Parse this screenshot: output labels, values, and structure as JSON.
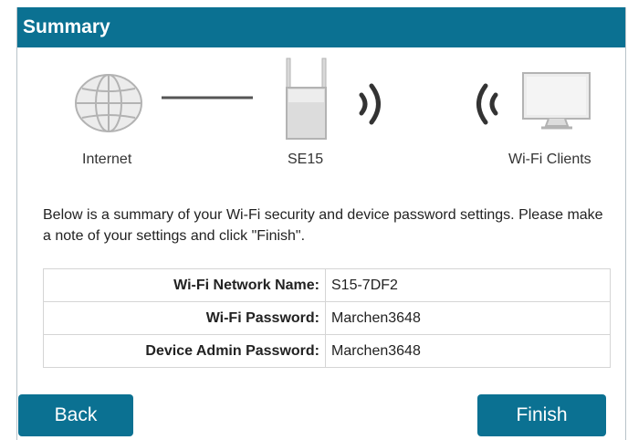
{
  "header": {
    "title": "Summary"
  },
  "diagram": {
    "internet_label": "Internet",
    "device_label": "SE15",
    "clients_label": "Wi-Fi Clients",
    "icons": [
      "globe-icon",
      "connection-line",
      "extender-icon",
      "signal-out-icon",
      "signal-in-icon",
      "monitor-icon"
    ]
  },
  "description": "Below is a summary of your Wi-Fi security and device password settings. Please make a note of your settings and click \"Finish\".",
  "settings": [
    {
      "label": "Wi-Fi Network Name:",
      "value": "S15-7DF2"
    },
    {
      "label": "Wi-Fi Password:",
      "value": "Marchen3648"
    },
    {
      "label": "Device Admin Password:",
      "value": "Marchen3648"
    }
  ],
  "buttons": {
    "back": "Back",
    "finish": "Finish"
  },
  "colors": {
    "accent": "#0b7192",
    "icon_gray": "#b3b3b3"
  }
}
